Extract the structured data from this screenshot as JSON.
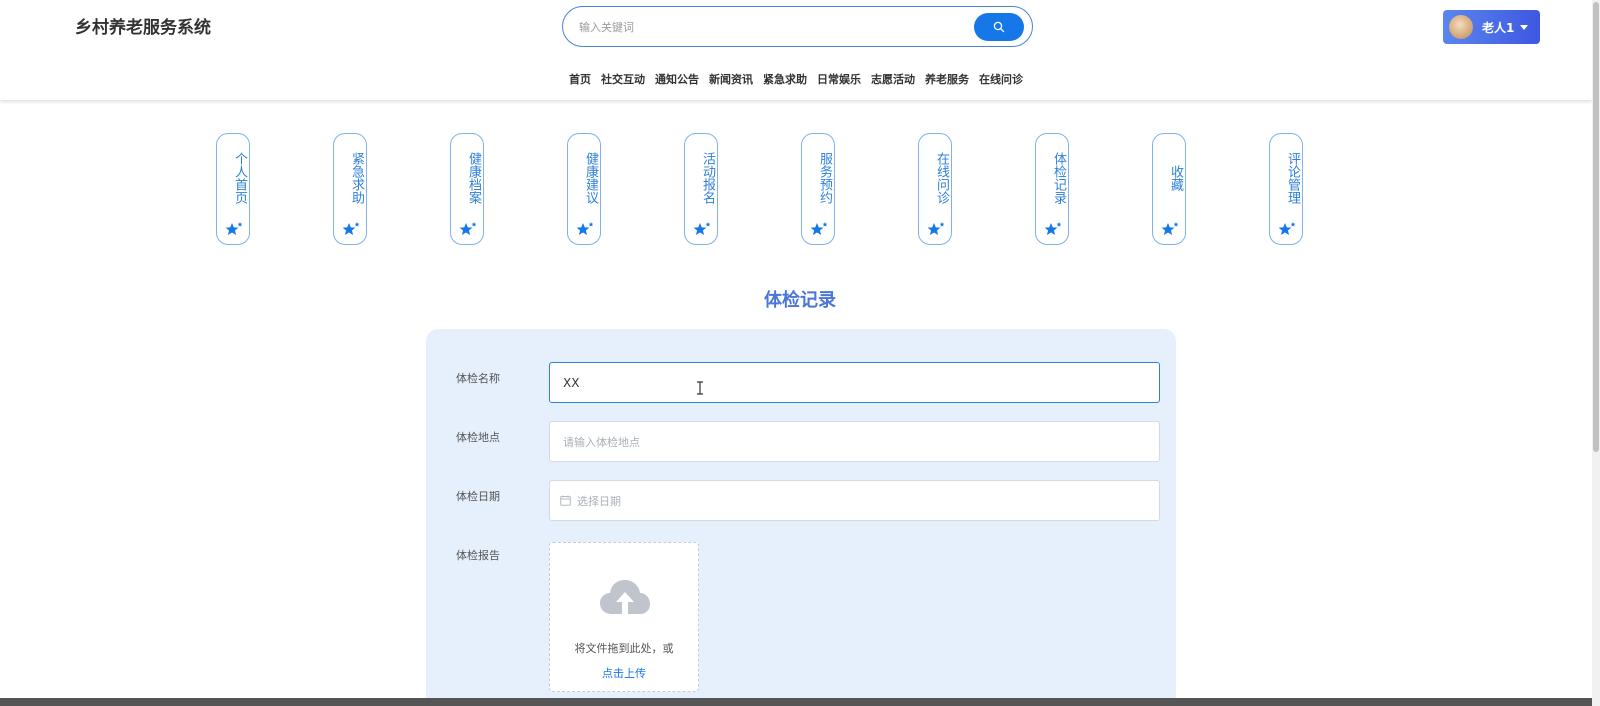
{
  "header": {
    "site_title": "乡村养老服务系统",
    "search": {
      "placeholder": "输入关键词",
      "value": ""
    },
    "user": {
      "name": "老人1"
    }
  },
  "nav": {
    "items": [
      "首页",
      "社交互动",
      "通知公告",
      "新闻资讯",
      "紧急求助",
      "日常娱乐",
      "志愿活动",
      "养老服务",
      "在线问诊"
    ]
  },
  "side_menu": {
    "items": [
      "个人首页",
      "紧急求助",
      "健康档案",
      "健康建议",
      "活动报名",
      "服务预约",
      "在线问诊",
      "体检记录",
      "收藏",
      "评论管理"
    ]
  },
  "form": {
    "heading": "体检记录",
    "name_label": "体检名称",
    "name_value": "XX",
    "location_label": "体检地点",
    "location_placeholder": "请输入体检地点",
    "date_label": "体检日期",
    "date_placeholder": "选择日期",
    "report_label": "体检报告",
    "upload_hint": "将文件拖到此处，或",
    "upload_link": "点击上传"
  },
  "colors": {
    "primary": "#1677e8",
    "accent_border": "#7fb2ec",
    "panel_bg": "#e6f0fd",
    "heading": "#4a76d8"
  },
  "icons": {
    "search": "search-icon",
    "menu": "star-icon",
    "date": "calendar-icon",
    "upload": "upload-cloud-icon",
    "user_menu": "caret-down-icon"
  }
}
